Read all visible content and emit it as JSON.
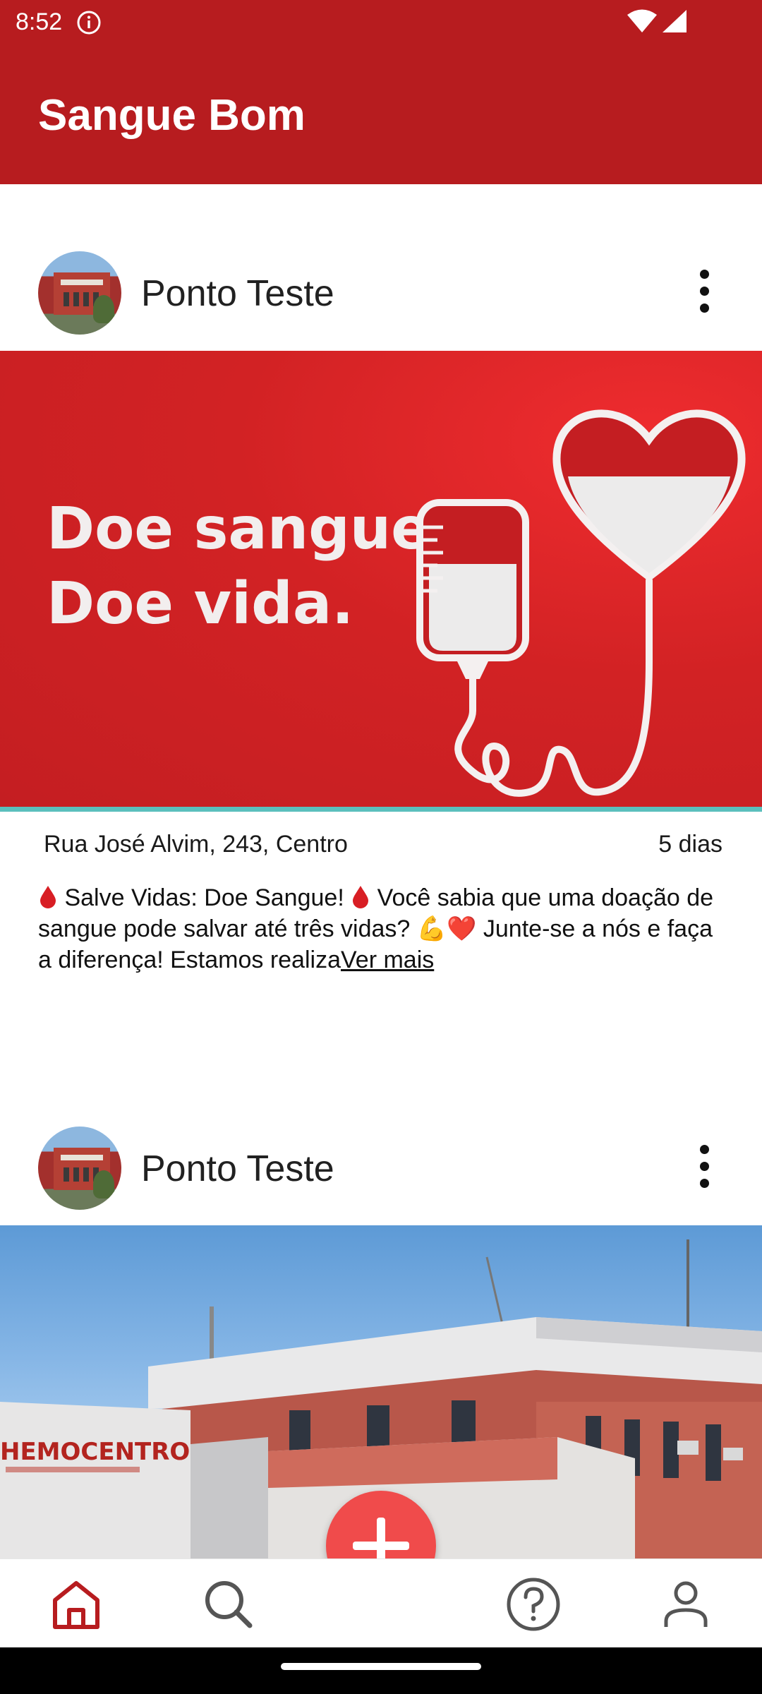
{
  "status_bar": {
    "time": "8:52"
  },
  "app_bar": {
    "title": "Sangue Bom"
  },
  "posts": [
    {
      "author": "Ponto Teste",
      "image_text_line1": "Doe sangue.",
      "image_text_line2": "Doe vida.",
      "address": "Rua José Alvim, 243, Centro",
      "time_ago": "5 dias",
      "text_part1": " Salve Vidas: Doe Sangue! ",
      "text_part2": " Você sabia que uma doação de sangue pode salvar até três vidas? 💪❤️ Junte-se a nós e faça a diferença! Estamos realiza",
      "see_more": "Ver mais"
    },
    {
      "author": "Ponto Teste",
      "image_text": "HEMOCENTRO"
    }
  ],
  "colors": {
    "primary": "#b71c1f",
    "fab": "#f04b4b",
    "nav_active": "#b71c1f",
    "nav_inactive": "#555555",
    "divider_accent": "#5bbfbd"
  },
  "icons": {
    "nav_home": "home-icon",
    "nav_search": "search-icon",
    "fab": "plus-icon",
    "nav_help": "help-icon",
    "nav_profile": "person-icon",
    "post_menu": "more-vert-icon"
  }
}
